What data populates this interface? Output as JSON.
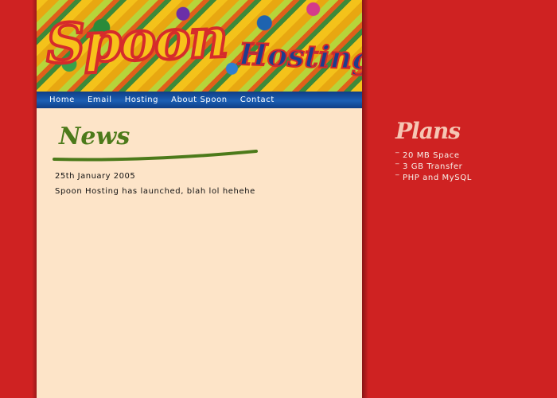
{
  "header": {
    "logo_main": "Spoon",
    "logo_sub": "Hosting"
  },
  "nav": {
    "items": [
      "Home",
      "Email",
      "Hosting",
      "About Spoon",
      "Contact"
    ]
  },
  "news": {
    "title": "News",
    "date": "25th January 2005",
    "body": "Spoon Hosting has launched, blah lol hehehe"
  },
  "plans": {
    "title": "Plans",
    "items": [
      "20 MB Space",
      "3 GB Transfer",
      "PHP and MySQL"
    ]
  },
  "colors": {
    "page_background": "#cf2222",
    "content_background": "#fde4c8",
    "nav_background": "#1b5fb5",
    "news_title": "#4c7a1a",
    "plans_title": "#f6c6b4"
  }
}
